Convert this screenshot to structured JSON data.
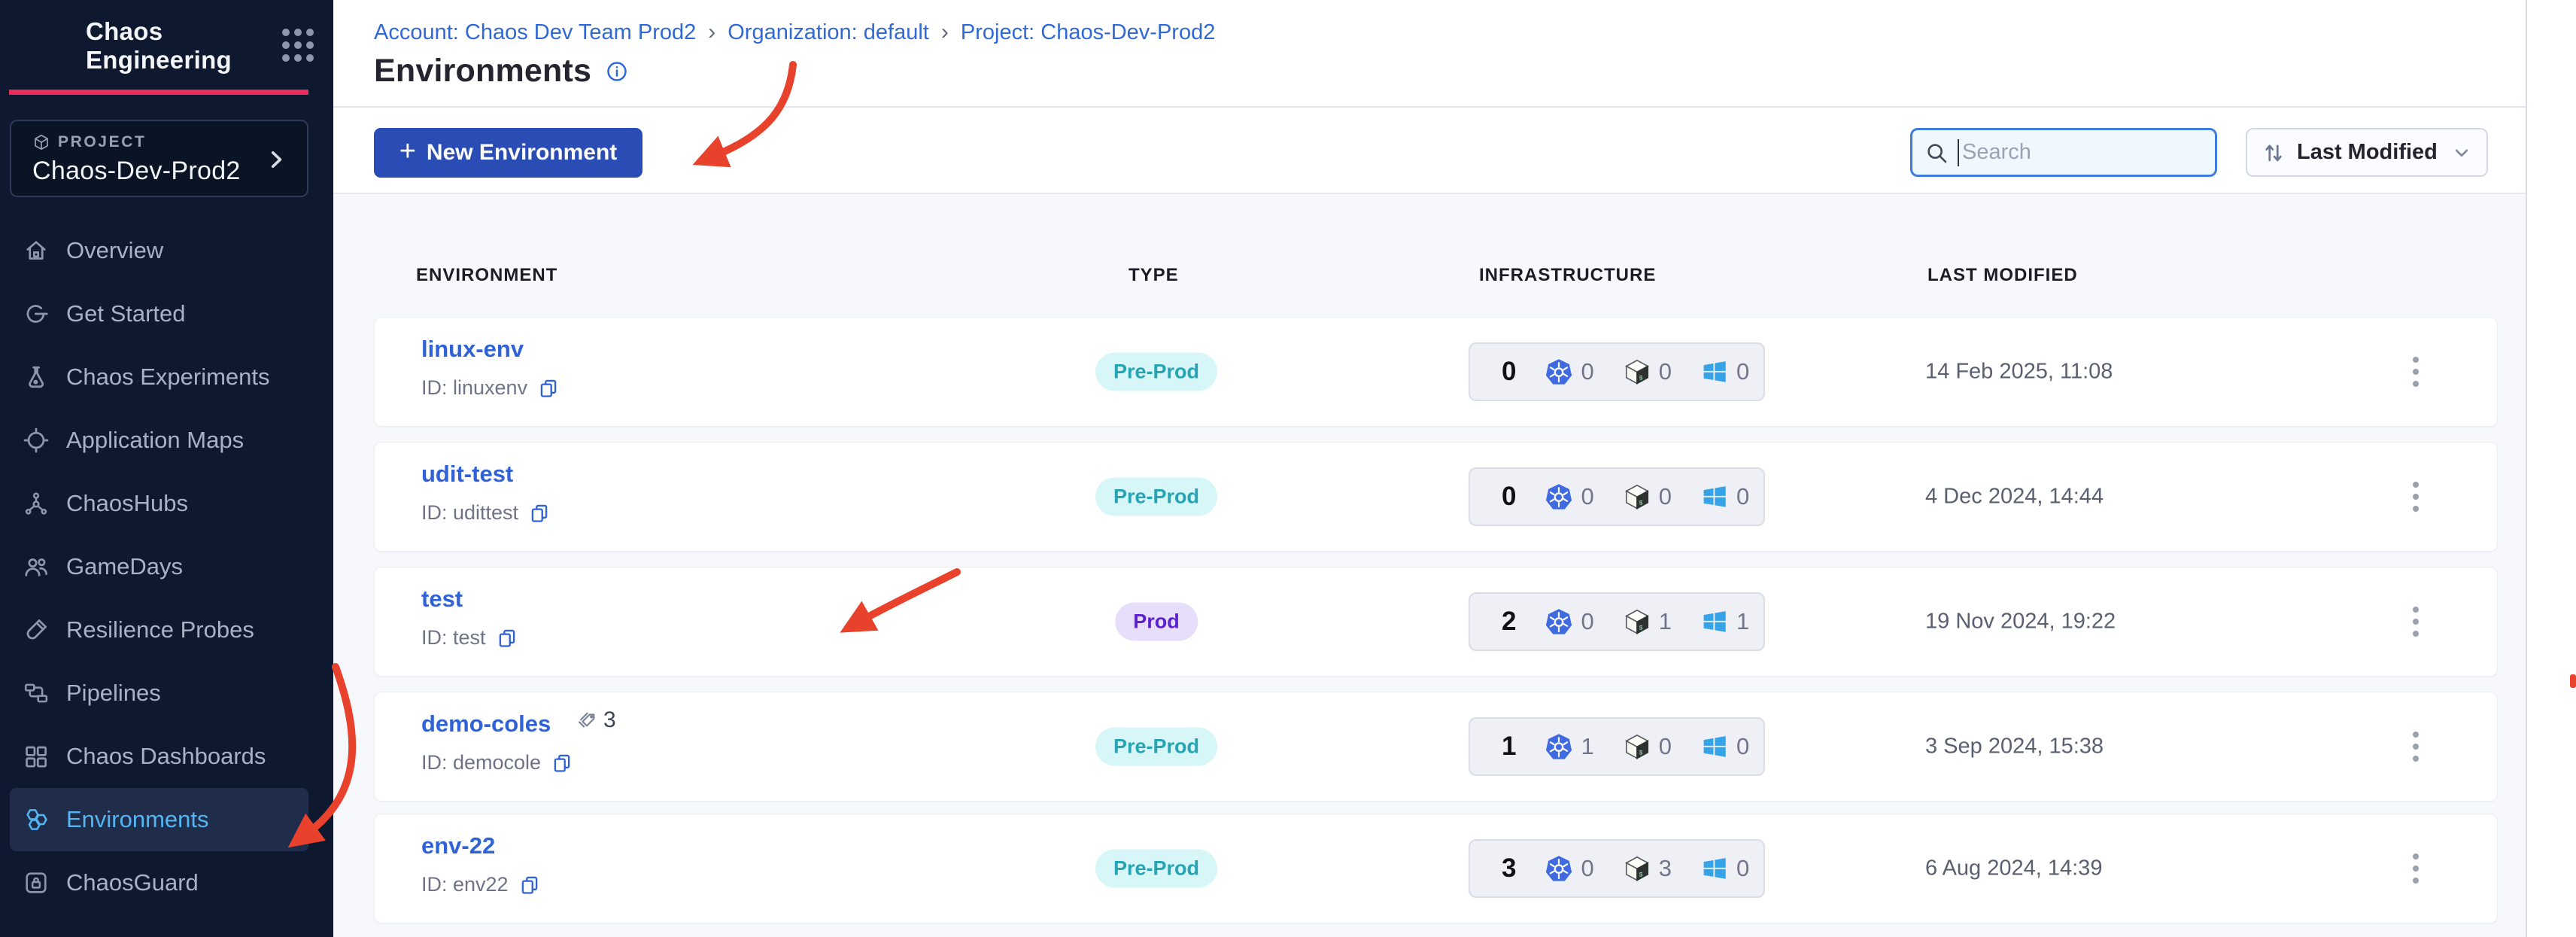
{
  "colors": {
    "accent_pink": "#ee2c5c",
    "primary_button_blue": "#2a4cb5",
    "link_blue": "#2f62d6",
    "selected_nav_blue": "#55b4f2",
    "preprod_badge_bg": "#d6f6f8",
    "preprod_badge_text": "#27a4b4",
    "prod_badge_bg": "#e6defa",
    "prod_badge_text": "#5b21cf",
    "annotation_red": "#e8412c",
    "sidebar_bg": "#0e1930"
  },
  "sidebar": {
    "brand": {
      "title": "Chaos Engineering"
    },
    "project": {
      "label": "PROJECT",
      "name": "Chaos-Dev-Prod2"
    },
    "items": [
      {
        "key": "overview",
        "label": "Overview",
        "icon": "home",
        "selected": false
      },
      {
        "key": "get-started",
        "label": "Get Started",
        "icon": "getstarted",
        "selected": false
      },
      {
        "key": "chaos-experiments",
        "label": "Chaos Experiments",
        "icon": "flask",
        "selected": false
      },
      {
        "key": "application-maps",
        "label": "Application Maps",
        "icon": "appmaps",
        "selected": false
      },
      {
        "key": "chaoshubs",
        "label": "ChaosHubs",
        "icon": "hubs",
        "selected": false
      },
      {
        "key": "gamedays",
        "label": "GameDays",
        "icon": "gamedays",
        "selected": false
      },
      {
        "key": "resilience-probes",
        "label": "Resilience Probes",
        "icon": "probe",
        "selected": false
      },
      {
        "key": "pipelines",
        "label": "Pipelines",
        "icon": "pipelines",
        "selected": false
      },
      {
        "key": "chaos-dashboards",
        "label": "Chaos Dashboards",
        "icon": "dashboards",
        "selected": false
      },
      {
        "key": "environments",
        "label": "Environments",
        "icon": "environments",
        "selected": true
      },
      {
        "key": "chaosguard",
        "label": "ChaosGuard",
        "icon": "guard",
        "selected": false
      }
    ]
  },
  "breadcrumb": {
    "items": [
      "Account: Chaos Dev Team Prod2",
      "Organization: default",
      "Project: Chaos-Dev-Prod2"
    ],
    "separator": "›"
  },
  "page": {
    "title": "Environments"
  },
  "toolbar": {
    "plus_glyph": "+",
    "new_environment_label": "New Environment",
    "search_placeholder": "Search",
    "sort_label": "Last Modified"
  },
  "table": {
    "headers": [
      "ENVIRONMENT",
      "TYPE",
      "INFRASTRUCTURE",
      "LAST MODIFIED"
    ],
    "rows": [
      {
        "name": "linux-env",
        "id_label": "ID: linuxenv",
        "tag_count": "",
        "type": "Pre-Prod",
        "total": "0",
        "k8s": "0",
        "linux": "0",
        "windows": "0",
        "last_modified": "14 Feb 2025, 11:08"
      },
      {
        "name": "udit-test",
        "id_label": "ID: udittest",
        "tag_count": "",
        "type": "Pre-Prod",
        "total": "0",
        "k8s": "0",
        "linux": "0",
        "windows": "0",
        "last_modified": "4 Dec 2024, 14:44"
      },
      {
        "name": "test",
        "id_label": "ID: test",
        "tag_count": "",
        "type": "Prod",
        "total": "2",
        "k8s": "0",
        "linux": "1",
        "windows": "1",
        "last_modified": "19 Nov 2024, 19:22"
      },
      {
        "name": "demo-coles",
        "id_label": "ID: democole",
        "tag_count": "3",
        "type": "Pre-Prod",
        "total": "1",
        "k8s": "1",
        "linux": "0",
        "windows": "0",
        "last_modified": "3 Sep 2024, 15:38"
      },
      {
        "name": "env-22",
        "id_label": "ID: env22",
        "tag_count": "",
        "type": "Pre-Prod",
        "total": "3",
        "k8s": "0",
        "linux": "3",
        "windows": "0",
        "last_modified": "6 Aug 2024, 14:39"
      }
    ]
  }
}
